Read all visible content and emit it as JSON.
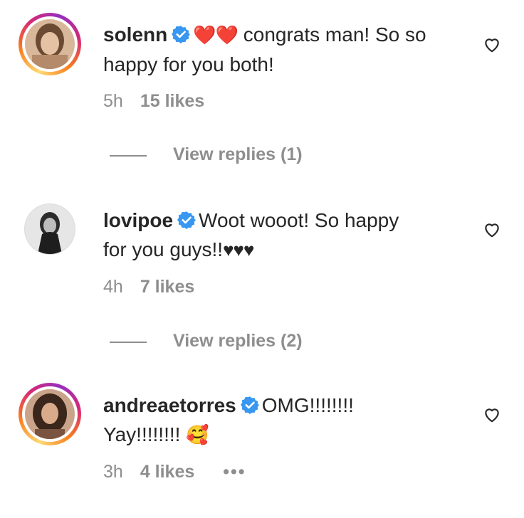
{
  "comments": [
    {
      "username": "solenn",
      "hearts": "❤️❤️",
      "text": " congrats man! So so happy for you both!",
      "time": "5h",
      "likes": "15 likes",
      "view_replies": "View replies (1)"
    },
    {
      "username": "lovipoe",
      "text_line1": "Woot wooot! So happy",
      "text_line2": "for you guys!!",
      "hearts": "♥♥♥",
      "time": "4h",
      "likes": "7 likes",
      "view_replies": "View replies (2)"
    },
    {
      "username": "andreaetorres",
      "text_line1": "OMG!!!!!!!!",
      "text_line2": "Yay!!!!!!!! ",
      "emoji": "🥰",
      "time": "3h",
      "likes": "4 likes",
      "more": "•••"
    }
  ],
  "icons": {
    "verified": "verified-badge-icon",
    "like": "heart-outline-icon"
  },
  "colors": {
    "verified_blue": "#3897f0",
    "muted": "#8e8e8e",
    "text": "#262626"
  }
}
